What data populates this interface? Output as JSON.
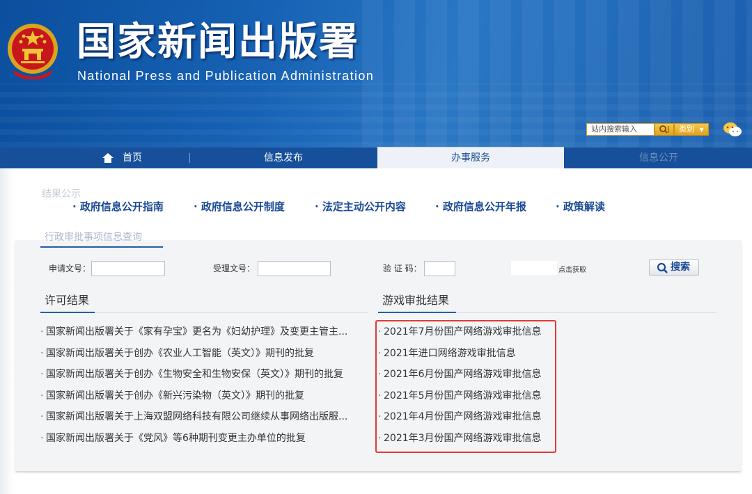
{
  "header": {
    "site_title": "国家新闻出版署",
    "site_subtitle": "National Press and Publication Administration",
    "search_placeholder": "站内搜索输入",
    "category_label": "类别"
  },
  "nav": {
    "items": [
      {
        "label": "首页"
      },
      {
        "label": "信息发布"
      },
      {
        "label": "办事服务"
      },
      {
        "label": "信息公开"
      }
    ]
  },
  "ghost": {
    "top_label": "结果公示",
    "under_label": "行政审批事项信息查询"
  },
  "policy_links": [
    "· 政府信息公开指南",
    "· 政府信息公开制度",
    "· 法定主动公开内容",
    "· 政府信息公开年报",
    "· 政策解读"
  ],
  "form": {
    "application_no_label": "申请文号：",
    "acceptance_no_label": "受理文号：",
    "captcha_label": "验 证 码：",
    "captcha_hint": "点击获取",
    "search_label": "搜索"
  },
  "license_results": {
    "title": "许可结果",
    "items": [
      "国家新闻出版署关于《家有孕宝》更名为《妇幼护理》及变更主管主...",
      "国家新闻出版署关于创办《农业人工智能（英文）》期刊的批复",
      "国家新闻出版署关于创办《生物安全和生物安保（英文）》期刊的批复",
      "国家新闻出版署关于创办《新兴污染物（英文）》期刊的批复",
      "国家新闻出版署关于上海双盟网络科技有限公司继续从事网络出版服...",
      "国家新闻出版署关于《党风》等6种期刊变更主办单位的批复"
    ]
  },
  "game_results": {
    "title": "游戏审批结果",
    "items": [
      "2021年7月份国产网络游戏审批信息",
      "2021年进口网络游戏审批信息",
      "2021年6月份国产网络游戏审批信息",
      "2021年5月份国产网络游戏审批信息",
      "2021年4月份国产网络游戏审批信息",
      "2021年3月份国产网络游戏审批信息"
    ]
  },
  "colors": {
    "header_blue": "#1762b4",
    "nav_blue": "#17509a",
    "link_blue": "#1a4a96",
    "highlight_red": "#e53935",
    "button_gold": "#e2a21c"
  }
}
